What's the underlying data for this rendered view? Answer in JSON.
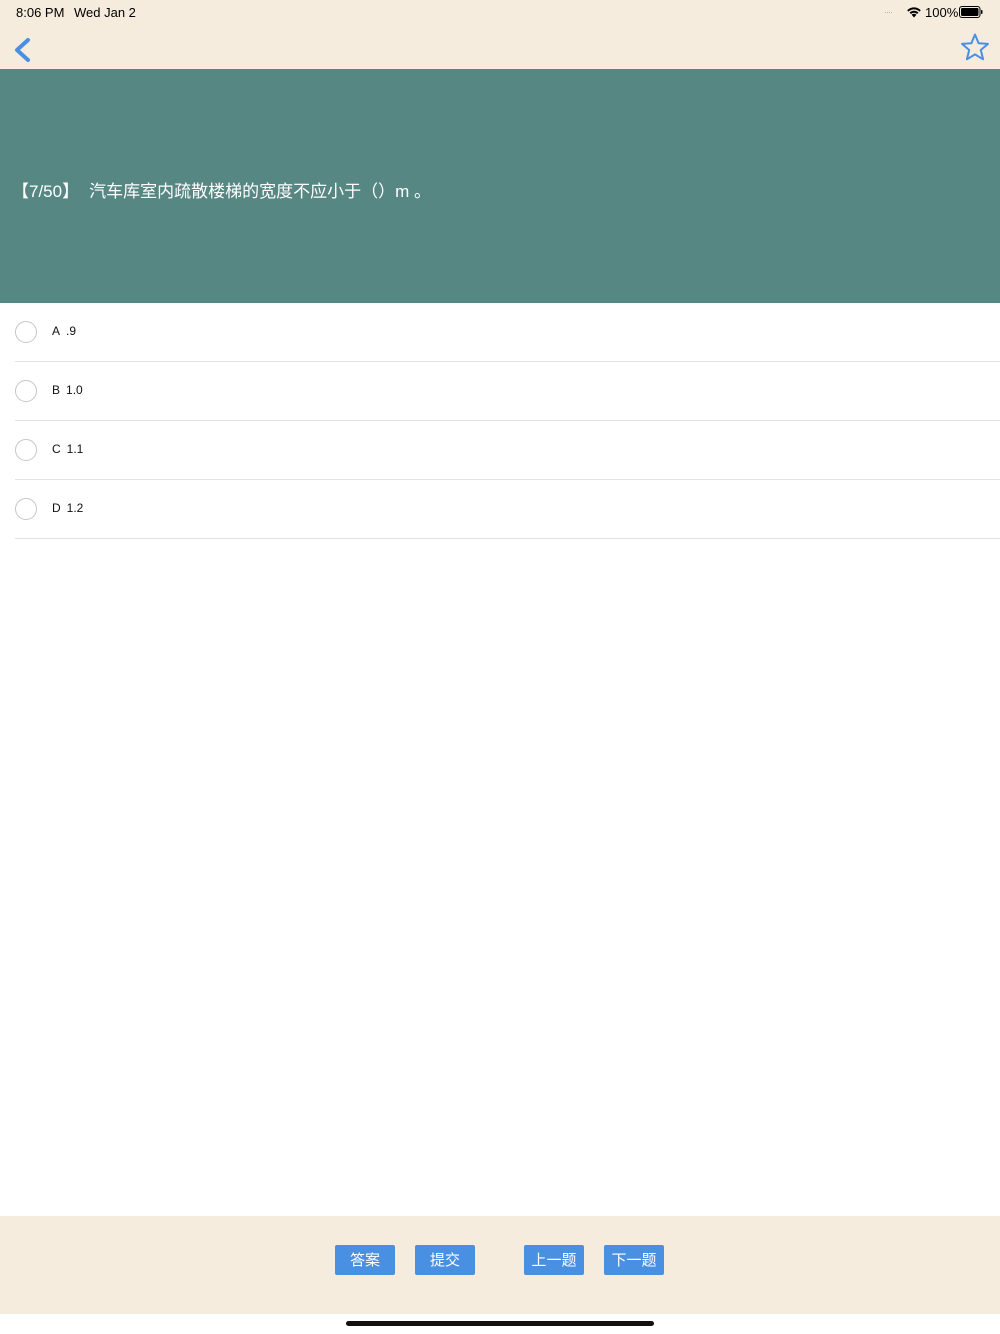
{
  "status_bar": {
    "time": "8:06 PM",
    "date": "Wed Jan 2",
    "signal": "····",
    "battery_percent": "100%"
  },
  "nav": {
    "back_icon": "chevron-left-icon",
    "favorite_icon": "star-outline-icon",
    "accent_color": "#4a90e2"
  },
  "question": {
    "number": "【7/50】",
    "text": "汽车库室内疏散楼梯的宽度不应小于（）m 。",
    "panel_color": "#568783"
  },
  "options": [
    {
      "letter": "A",
      "text": ".9",
      "selected": false
    },
    {
      "letter": "B",
      "text": "1.0",
      "selected": false
    },
    {
      "letter": "C",
      "text": "1.1",
      "selected": false
    },
    {
      "letter": "D",
      "text": "1.2",
      "selected": false
    }
  ],
  "bottom_bar": {
    "answer_label": "答案",
    "submit_label": "提交",
    "prev_label": "上一题",
    "next_label": "下一题",
    "button_color": "#4a90e2",
    "background_color": "#f5ecdd"
  }
}
